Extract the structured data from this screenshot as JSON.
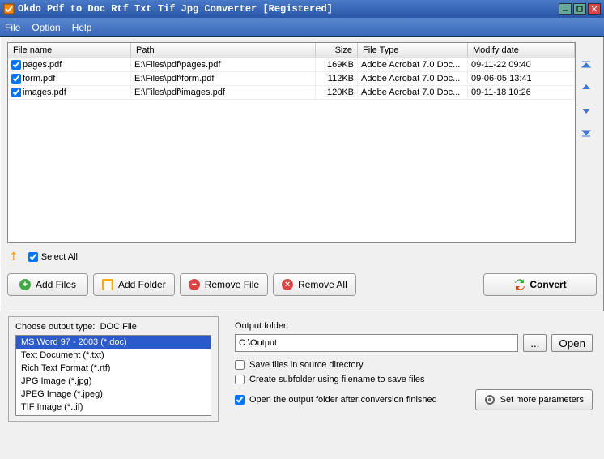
{
  "title": "Okdo Pdf to Doc Rtf Txt Tif Jpg Converter  [Registered]",
  "menu": {
    "file": "File",
    "option": "Option",
    "help": "Help"
  },
  "columns": {
    "name": "File name",
    "path": "Path",
    "size": "Size",
    "type": "File Type",
    "date": "Modify date"
  },
  "rows": [
    {
      "checked": true,
      "name": "pages.pdf",
      "path": "E:\\Files\\pdf\\pages.pdf",
      "size": "169KB",
      "type": "Adobe Acrobat 7.0 Doc...",
      "date": "09-11-22 09:40"
    },
    {
      "checked": true,
      "name": "form.pdf",
      "path": "E:\\Files\\pdf\\form.pdf",
      "size": "112KB",
      "type": "Adobe Acrobat 7.0 Doc...",
      "date": "09-06-05 13:41"
    },
    {
      "checked": true,
      "name": "images.pdf",
      "path": "E:\\Files\\pdf\\images.pdf",
      "size": "120KB",
      "type": "Adobe Acrobat 7.0 Doc...",
      "date": "09-11-18 10:26"
    }
  ],
  "selectAll": "Select All",
  "buttons": {
    "addFiles": "Add Files",
    "addFolder": "Add Folder",
    "removeFile": "Remove File",
    "removeAll": "Remove All",
    "convert": "Convert"
  },
  "outputType": {
    "label": "Choose output type:",
    "current": "DOC File",
    "items": [
      "MS Word 97 - 2003 (*.doc)",
      "Text Document (*.txt)",
      "Rich Text Format (*.rtf)",
      "JPG Image (*.jpg)",
      "JPEG Image (*.jpeg)",
      "TIF Image (*.tif)"
    ],
    "selected": 0
  },
  "outputPanel": {
    "label": "Output folder:",
    "path": "C:\\Output",
    "browse": "...",
    "open": "Open",
    "saveSource": "Save files in source directory",
    "createSub": "Create subfolder using filename to save files",
    "openAfter": "Open the output folder after conversion finished",
    "openAfterChecked": true,
    "params": "Set more parameters"
  }
}
